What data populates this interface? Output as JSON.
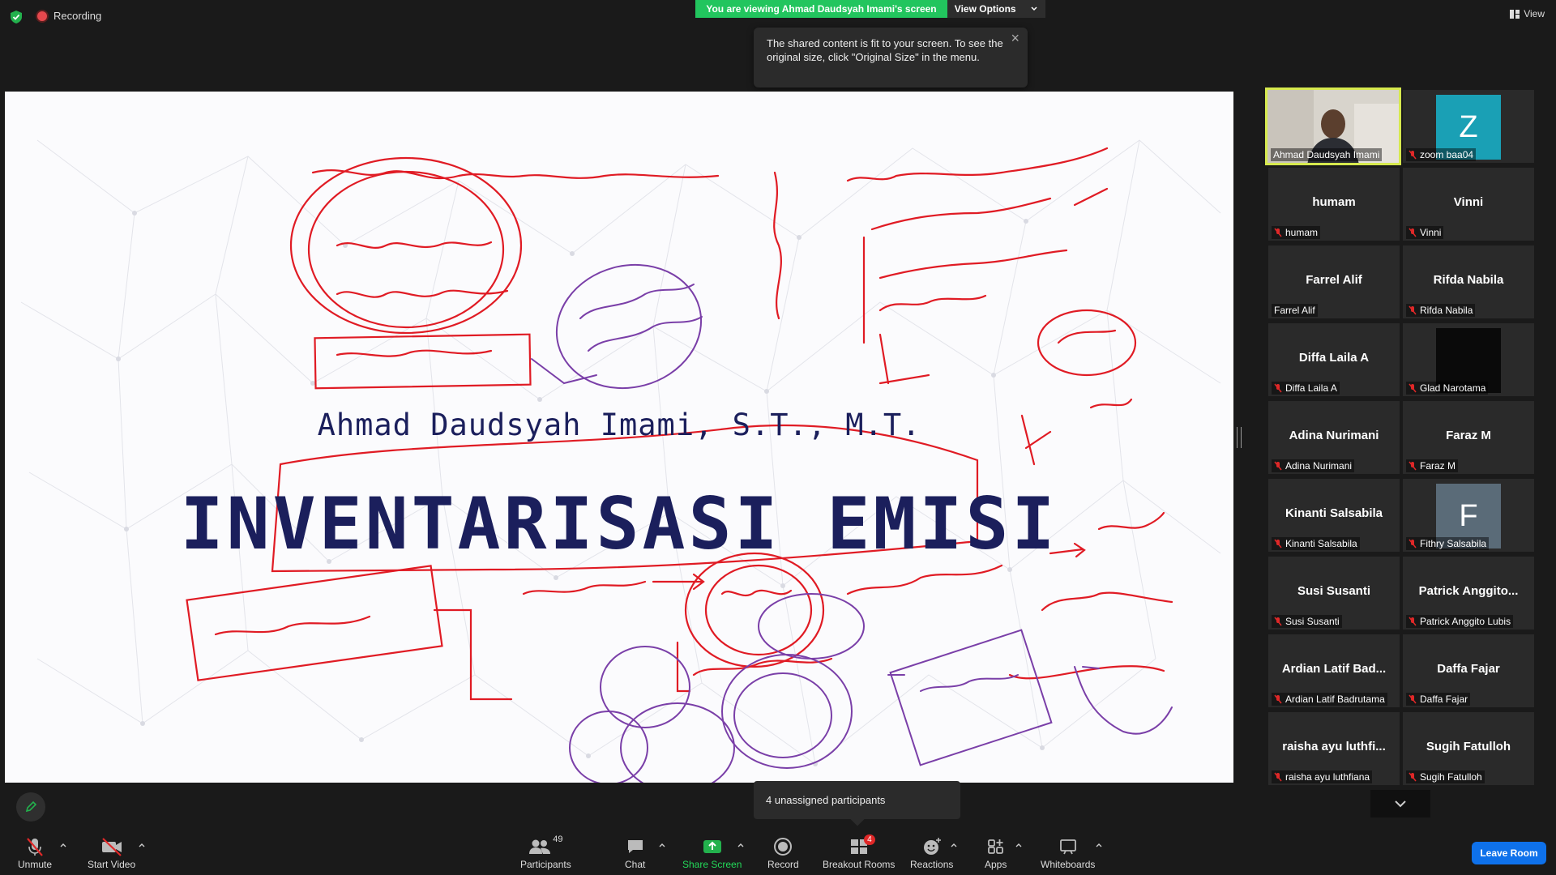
{
  "topbar": {
    "recording_label": "Recording",
    "viewing_banner": "You are viewing Ahmad Daudsyah Imami's screen",
    "view_options_label": "View Options",
    "view_button_label": "View",
    "tooltip_text": "The shared content is fit to your screen. To see the original size, click \"Original Size\" in the menu."
  },
  "slide": {
    "author": "Ahmad Daudsyah Imami, S.T., M.T.",
    "title": "INVENTARISASI EMISI"
  },
  "participants": [
    {
      "display": "",
      "label": "Ahmad Daudsyah Imami",
      "type": "video",
      "muted": false
    },
    {
      "display": "Z",
      "label": "zoom baa04",
      "type": "avatar",
      "avatar_color": "#1aa0b5",
      "muted": true
    },
    {
      "display": "humam",
      "label": "humam",
      "type": "name",
      "muted": true
    },
    {
      "display": "Vinni",
      "label": "Vinni",
      "type": "name",
      "muted": true
    },
    {
      "display": "Farrel Alif",
      "label": "Farrel Alif",
      "type": "name",
      "muted": false
    },
    {
      "display": "Rifda Nabila",
      "label": "Rifda Nabila",
      "type": "name",
      "muted": true
    },
    {
      "display": "Diffa Laila A",
      "label": "Diffa Laila A",
      "type": "name",
      "muted": true
    },
    {
      "display": "",
      "label": "Glad Narotama",
      "type": "avatar",
      "avatar_color": "#0a0a0a",
      "muted": true
    },
    {
      "display": "Adina Nurimani",
      "label": "Adina Nurimani",
      "type": "name",
      "muted": true
    },
    {
      "display": "Faraz M",
      "label": "Faraz M",
      "type": "name",
      "muted": true
    },
    {
      "display": "Kinanti Salsabila",
      "label": "Kinanti Salsabila",
      "type": "name",
      "muted": true
    },
    {
      "display": "F",
      "label": "Fithry Salsabila",
      "type": "avatar",
      "avatar_color": "#5a6b78",
      "muted": true
    },
    {
      "display": "Susi Susanti",
      "label": "Susi Susanti",
      "type": "name",
      "muted": true
    },
    {
      "display": "Patrick Anggito...",
      "label": "Patrick Anggito Lubis",
      "type": "name",
      "muted": true
    },
    {
      "display": "Ardian Latif Bad...",
      "label": "Ardian Latif Badrutama",
      "type": "name",
      "muted": true
    },
    {
      "display": "Daffa Fajar",
      "label": "Daffa Fajar",
      "type": "name",
      "muted": true
    },
    {
      "display": "raisha ayu luthfi...",
      "label": "raisha ayu luthfiana",
      "type": "name",
      "muted": true
    },
    {
      "display": "Sugih Fatulloh",
      "label": "Sugih Fatulloh",
      "type": "name",
      "muted": true
    }
  ],
  "unassigned_popup": "4 unassigned participants",
  "toolbar": {
    "unmute": "Unmute",
    "start_video": "Start Video",
    "participants": "Participants",
    "participants_count": "49",
    "chat": "Chat",
    "share_screen": "Share Screen",
    "record": "Record",
    "breakout_rooms": "Breakout Rooms",
    "breakout_badge": "4",
    "reactions": "Reactions",
    "apps": "Apps",
    "whiteboards": "Whiteboards",
    "leave_room": "Leave Room"
  },
  "colors": {
    "share_green": "#22c55e",
    "leave_blue": "#0e71eb",
    "ink_red": "#e01b24",
    "ink_purple": "#7a3fa8",
    "slide_text": "#1b1f5c",
    "active_speaker": "#d6e94e"
  }
}
